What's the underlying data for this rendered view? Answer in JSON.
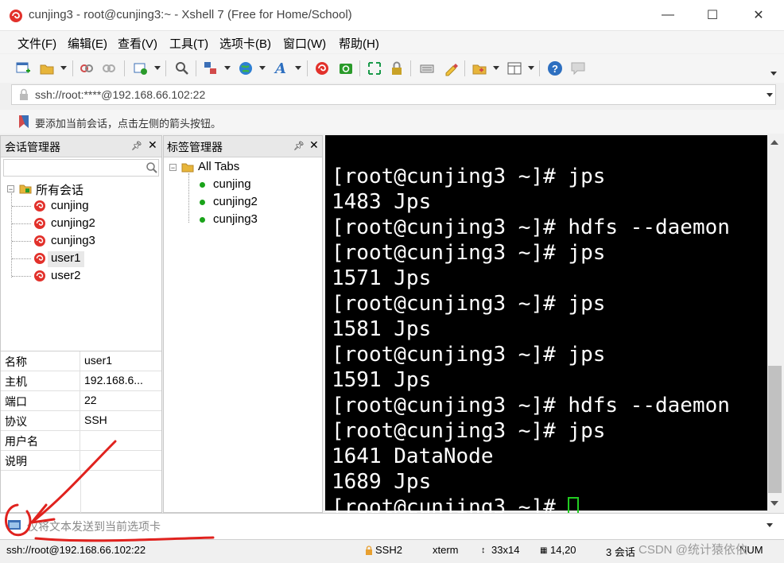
{
  "window": {
    "title": "cunjing3 - root@cunjing3:~ - Xshell 7 (Free for Home/School)",
    "buttons": [
      "—",
      "☐",
      "✕"
    ]
  },
  "menu": [
    "文件(F)",
    "编辑(E)",
    "查看(V)",
    "工具(T)",
    "选项卡(B)",
    "窗口(W)",
    "帮助(H)"
  ],
  "toolbar": {
    "icons": [
      "new-session-icon",
      "open-folder-icon",
      "reconnect-icon",
      "disconnect-icon",
      "new-tab-icon",
      "find-icon",
      "transfer-icon",
      "globe-icon",
      "font-icon",
      "xshell-icon",
      "xftp-icon",
      "fullscreen-icon",
      "lock-icon",
      "keyboard-icon",
      "highlight-icon",
      "add-folder-icon",
      "layout-icon",
      "help-icon",
      "chat-icon"
    ]
  },
  "address": {
    "value": "ssh://root:****@192.168.66.102:22"
  },
  "hint": {
    "text": "要添加当前会话，点击左侧的箭头按钮。"
  },
  "session_manager": {
    "title": "会话管理器",
    "search_placeholder": "",
    "root": "所有会话",
    "sessions": [
      "cunjing",
      "cunjing2",
      "cunjing3",
      "user1",
      "user2"
    ]
  },
  "tab_manager": {
    "title": "标签管理器",
    "root": "All Tabs",
    "tabs": [
      "cunjing",
      "cunjing2",
      "cunjing3"
    ]
  },
  "properties": [
    {
      "key": "名称",
      "value": "user1"
    },
    {
      "key": "主机",
      "value": "192.168.6..."
    },
    {
      "key": "端口",
      "value": "22"
    },
    {
      "key": "协议",
      "value": "SSH"
    },
    {
      "key": "用户名",
      "value": ""
    },
    {
      "key": "说明",
      "value": ""
    }
  ],
  "terminal": {
    "lines": [
      "[root@cunjing3 ~]# jps",
      "1483 Jps",
      "[root@cunjing3 ~]# hdfs --daemon",
      "[root@cunjing3 ~]# jps",
      "1571 Jps",
      "[root@cunjing3 ~]# jps",
      "1581 Jps",
      "[root@cunjing3 ~]# jps",
      "1591 Jps",
      "[root@cunjing3 ~]# hdfs --daemon",
      "[root@cunjing3 ~]# jps",
      "1641 DataNode",
      "1689 Jps"
    ],
    "prompt": "[root@cunjing3 ~]# "
  },
  "sendbar": {
    "placeholder": "仅将文本发送到当前选项卡"
  },
  "status": {
    "address": "ssh://root@192.168.66.102:22",
    "protocol": "SSH2",
    "term": "xterm",
    "size": "33x14",
    "cursor": "14,20",
    "sessions": "3 会话",
    "num": "NUM",
    "watermark": "CSDN @统计猿依依"
  },
  "colors": {
    "terminal_bg": "#000000",
    "terminal_fg": "#ffffff",
    "cursor": "#22cc22",
    "annotation": "#e0221e"
  }
}
